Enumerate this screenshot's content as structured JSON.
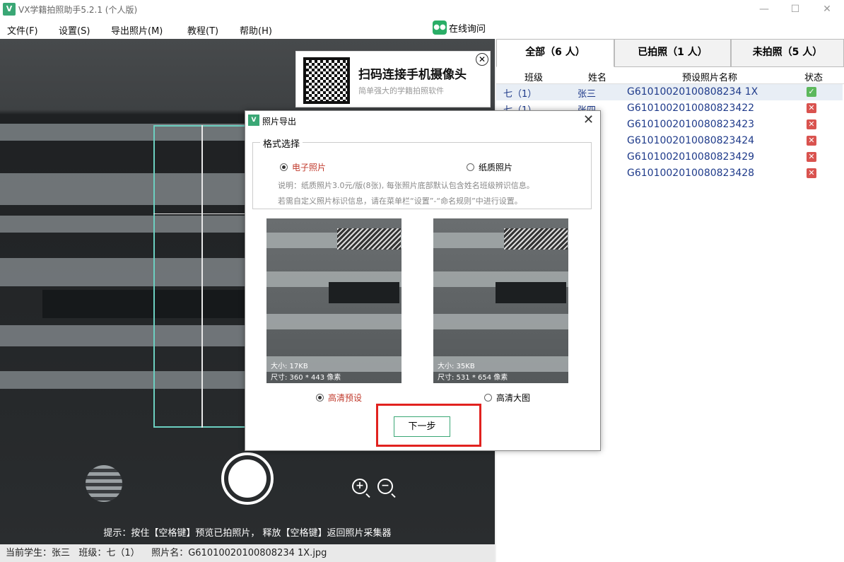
{
  "window": {
    "title": "VX学籍拍照助手5.2.1 (个人版)",
    "logo": "V",
    "controls": [
      "—",
      "☐",
      "✕"
    ]
  },
  "menu": {
    "items": [
      "文件(F)",
      "设置(S)",
      "导出照片(M)",
      "教程(T)",
      "帮助(H)"
    ],
    "online": "在线询问"
  },
  "camera": {
    "qr_title": "扫码连接手机摄像头",
    "qr_subtitle": "简单强大的学籍拍照软件",
    "hint": "提示：按住【空格键】预览已拍照片， 释放【空格键】返回照片采集器",
    "zoom_in": "+",
    "zoom_out": "−"
  },
  "status": {
    "text": "当前学生：张三   班级：七（1）    照片名：G61010020100808234 1X.jpg"
  },
  "tabs": [
    "全部（6 人）",
    "已拍照（1 人）",
    "未拍照（5 人）"
  ],
  "table": {
    "headers": [
      "班级",
      "姓名",
      "预设照片名称",
      "状态"
    ],
    "rows": [
      {
        "cls": "七（1）",
        "name": "张三",
        "file": "G61010020100808234 1X",
        "status": "ok"
      },
      {
        "cls": "七（1）",
        "name": "张四",
        "file": "G6101002010080823422",
        "status": "no"
      },
      {
        "cls": "",
        "name": "",
        "file": "G6101002010080823423",
        "status": "no"
      },
      {
        "cls": "",
        "name": "",
        "file": "G6101002010080823424",
        "status": "no"
      },
      {
        "cls": "",
        "name": "",
        "file": "G6101002010080823429",
        "status": "no"
      },
      {
        "cls": "",
        "name": "",
        "file": "G6101002010080823428",
        "status": "no"
      }
    ]
  },
  "dialog": {
    "title": "照片导出",
    "logo": "V",
    "close": "✕",
    "format_legend": "格式选择",
    "option_electronic": "电子照片",
    "option_paper": "纸质照片",
    "note1": "说明：纸质照片3.0元/版(8张), 每张照片底部默认包含姓名班级辨识信息。",
    "note2": "若需自定义照片标识信息，请在菜单栏“设置”-“命名规则”中进行设置。",
    "preview1_size": "大小: 17KB",
    "preview1_dim": "尺寸: 360 * 443 像素",
    "preview1_label": "高清预设",
    "preview2_size": "大小: 35KB",
    "preview2_dim": "尺寸: 531 * 654 像素",
    "preview2_label": "高清大图",
    "next": "下一步"
  },
  "colors": {
    "accent": "#3aa775",
    "highlight_frame": "#e1221f",
    "guide": "#6ccfc0",
    "ok": "#5cb85c",
    "no": "#d9534f"
  }
}
